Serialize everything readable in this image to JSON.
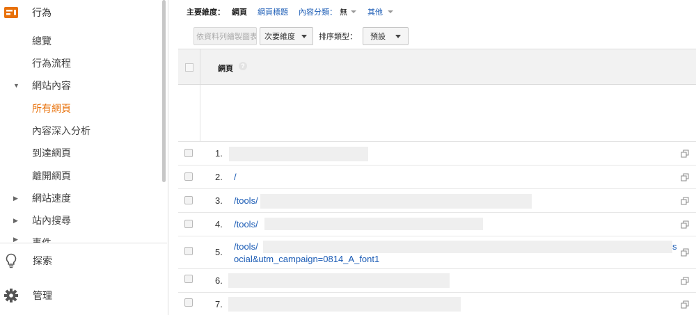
{
  "sidebar": {
    "top_label": "行為",
    "items": [
      {
        "label": "總覽",
        "arrow": "",
        "active": false
      },
      {
        "label": "行為流程",
        "arrow": "",
        "active": false
      },
      {
        "label": "網站內容",
        "arrow": "▼",
        "active": false
      },
      {
        "label": "所有網頁",
        "arrow": "",
        "active": true
      },
      {
        "label": "內容深入分析",
        "arrow": "",
        "active": false
      },
      {
        "label": "到達網頁",
        "arrow": "",
        "active": false
      },
      {
        "label": "離開網頁",
        "arrow": "",
        "active": false
      },
      {
        "label": "網站速度",
        "arrow": "▶",
        "active": false
      },
      {
        "label": "站內搜尋",
        "arrow": "▶",
        "active": false
      },
      {
        "label": "事件",
        "arrow": "▶",
        "active": false
      }
    ],
    "discover_label": "探索",
    "admin_label": "管理"
  },
  "dimensions": {
    "prefix": "主要維度：",
    "current": "網頁",
    "page_title": "網頁標題",
    "content_grouping": "內容分類：",
    "content_grouping_value": "無",
    "other": "其他"
  },
  "toolbar": {
    "plot_rows": "依資料列繪製圖表",
    "secondary_dimension": "次要維度",
    "sort_type_label": "排序類型：",
    "sort_type_value": "預設"
  },
  "table": {
    "header": "網頁",
    "help": "?",
    "rows": [
      {
        "num": "1.",
        "line1": "",
        "line2": ""
      },
      {
        "num": "2.",
        "line1": "/",
        "line2": ""
      },
      {
        "num": "3.",
        "line1": "/tools/",
        "line2": ""
      },
      {
        "num": "4.",
        "line1": "/tools/",
        "line2": ""
      },
      {
        "num": "5.",
        "line1": "/tools/",
        "line1_end": "s",
        "line2": "ocial&utm_campaign=0814_A_font1"
      },
      {
        "num": "6.",
        "line1": "",
        "line2": ""
      },
      {
        "num": "7.",
        "line1": "",
        "line2": ""
      }
    ]
  },
  "colors": {
    "accent": "#e8710a",
    "link": "#1a5bb5"
  }
}
